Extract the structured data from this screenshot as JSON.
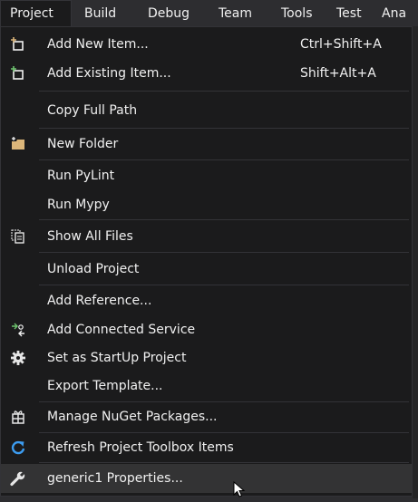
{
  "menubar": {
    "items": [
      "Project",
      "Build",
      "Debug",
      "Team",
      "Tools",
      "Test",
      "Ana"
    ]
  },
  "menu": {
    "items": [
      {
        "label": "Add New Item...",
        "shortcut": "Ctrl+Shift+A",
        "icon": "add-new-item-icon"
      },
      {
        "label": "Add Existing Item...",
        "shortcut": "Shift+Alt+A",
        "icon": "add-existing-item-icon"
      },
      {
        "label": "Copy Full Path",
        "shortcut": "",
        "icon": ""
      },
      {
        "label": "New Folder",
        "shortcut": "",
        "icon": "new-folder-icon"
      },
      {
        "label": "Run PyLint",
        "shortcut": "",
        "icon": ""
      },
      {
        "label": "Run Mypy",
        "shortcut": "",
        "icon": ""
      },
      {
        "label": "Show All Files",
        "shortcut": "",
        "icon": "show-all-files-icon"
      },
      {
        "label": "Unload Project",
        "shortcut": "",
        "icon": ""
      },
      {
        "label": "Add Reference...",
        "shortcut": "",
        "icon": ""
      },
      {
        "label": "Add Connected Service",
        "shortcut": "",
        "icon": "connected-service-icon"
      },
      {
        "label": "Set as StartUp Project",
        "shortcut": "",
        "icon": "gear-icon"
      },
      {
        "label": "Export Template...",
        "shortcut": "",
        "icon": ""
      },
      {
        "label": "Manage NuGet Packages...",
        "shortcut": "",
        "icon": "nuget-package-icon"
      },
      {
        "label": "Refresh Project Toolbox Items",
        "shortcut": "",
        "icon": "refresh-icon"
      },
      {
        "label": "generic1 Properties...",
        "shortcut": "",
        "icon": "wrench-icon"
      }
    ]
  },
  "colors": {
    "background": "#1b1b1c",
    "text": "#f1f1f1",
    "hover": "#333334",
    "separator": "#333337",
    "icon_blue": "#3c9cf0",
    "folder_yellow": "#dcb67a"
  }
}
